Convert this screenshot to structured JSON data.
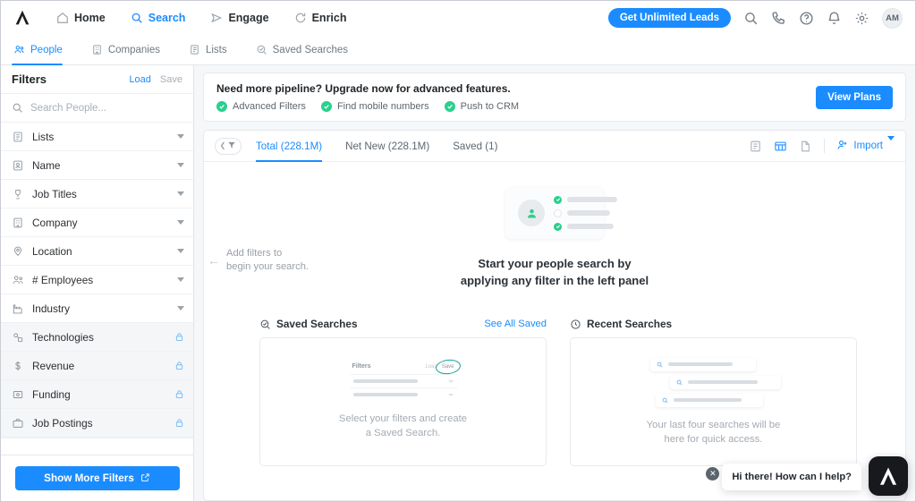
{
  "topnav": {
    "logo_name": "apollo-logo",
    "items": [
      {
        "label": "Home",
        "icon": "home-icon",
        "active": false
      },
      {
        "label": "Search",
        "icon": "search-icon",
        "active": true
      },
      {
        "label": "Engage",
        "icon": "send-icon",
        "active": false
      },
      {
        "label": "Enrich",
        "icon": "refresh-icon",
        "active": false
      }
    ],
    "cta_label": "Get Unlimited Leads",
    "icons": [
      "search-icon",
      "phone-icon",
      "help-icon",
      "bell-icon",
      "gear-icon"
    ],
    "avatar_initials": "AM"
  },
  "subnav": {
    "tabs": [
      {
        "label": "People",
        "icon": "people-icon",
        "active": true
      },
      {
        "label": "Companies",
        "icon": "building-icon",
        "active": false
      },
      {
        "label": "Lists",
        "icon": "list-icon",
        "active": false
      },
      {
        "label": "Saved Searches",
        "icon": "saved-search-icon",
        "active": false
      }
    ]
  },
  "sidebar": {
    "title": "Filters",
    "load_label": "Load",
    "save_label": "Save",
    "search_placeholder": "Search People...",
    "search_value": "",
    "filters": [
      {
        "label": "Lists",
        "icon": "list-icon",
        "locked": false
      },
      {
        "label": "Name",
        "icon": "badge-icon",
        "locked": false
      },
      {
        "label": "Job Titles",
        "icon": "job-title-icon",
        "locked": false
      },
      {
        "label": "Company",
        "icon": "building-icon",
        "locked": false
      },
      {
        "label": "Location",
        "icon": "pin-icon",
        "locked": false
      },
      {
        "label": "# Employees",
        "icon": "people-icon",
        "locked": false
      },
      {
        "label": "Industry",
        "icon": "industry-icon",
        "locked": false
      },
      {
        "label": "Technologies",
        "icon": "tech-icon",
        "locked": true
      },
      {
        "label": "Revenue",
        "icon": "dollar-icon",
        "locked": true
      },
      {
        "label": "Funding",
        "icon": "funding-icon",
        "locked": true
      },
      {
        "label": "Job Postings",
        "icon": "briefcase-icon",
        "locked": true
      }
    ],
    "show_more_label": "Show More Filters"
  },
  "promo": {
    "headline": "Need more pipeline? Upgrade now for advanced features.",
    "features": [
      "Advanced Filters",
      "Find mobile numbers",
      "Push to CRM"
    ],
    "button_label": "View Plans"
  },
  "panel": {
    "filter_pill_icon": "funnel-icon",
    "tabs": [
      {
        "label": "Total (228.1M)",
        "active": true
      },
      {
        "label": "Net New (228.1M)",
        "active": false
      },
      {
        "label": "Saved (1)",
        "active": false
      }
    ],
    "view_icons": [
      {
        "name": "list-view-icon",
        "active": false
      },
      {
        "name": "table-view-icon",
        "active": true
      },
      {
        "name": "file-view-icon",
        "active": false
      }
    ],
    "import_label": "Import"
  },
  "hint": {
    "line1": "Add filters to",
    "line2": "begin your search."
  },
  "empty_state": {
    "line1": "Start your people search by",
    "line2": "applying any filter in the left panel"
  },
  "saved_searches": {
    "title": "Saved Searches",
    "link_label": "See All Saved",
    "illustration": {
      "filters_label": "Filters",
      "load_label": "Load",
      "save_label": "Save"
    },
    "caption_line1": "Select your filters and create",
    "caption_line2": "a Saved Search."
  },
  "recent_searches": {
    "title": "Recent Searches",
    "caption_line1": "Your last four searches will be",
    "caption_line2": "here for quick access."
  },
  "chat": {
    "message": "Hi there! How can I help?",
    "close_label": "✕"
  },
  "colors": {
    "accent_blue": "#1a8cff",
    "green": "#2bcf8e",
    "teal_ring": "#17a398",
    "text_dark": "#1f2428",
    "text_muted": "#6f7880",
    "page_bg": "#f5f7f9"
  }
}
